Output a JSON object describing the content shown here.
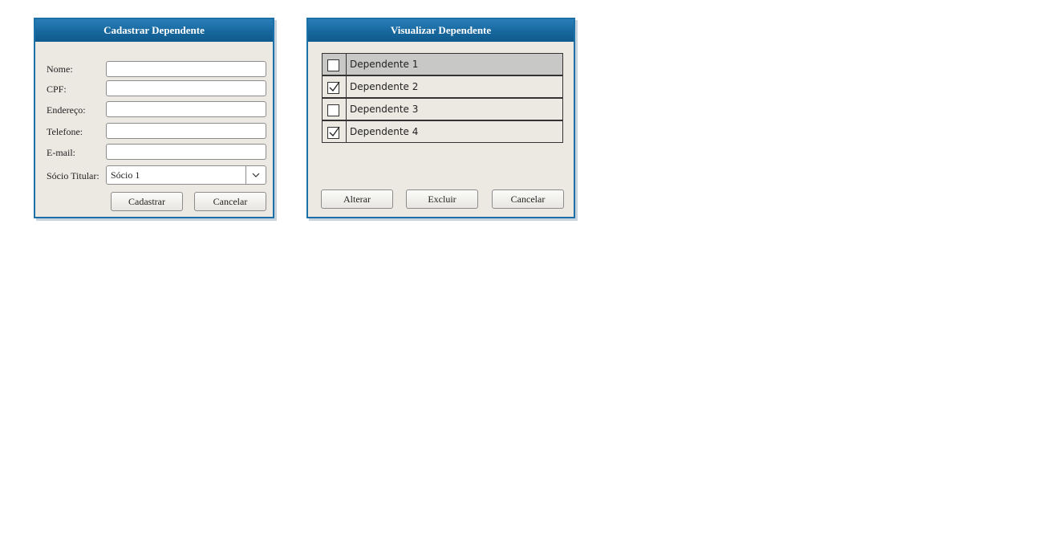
{
  "cadastrar": {
    "title": "Cadastrar Dependente",
    "fields": {
      "nome_label": "Nome:",
      "cpf_label": "CPF:",
      "endereco_label": "Endereço:",
      "telefone_label": "Telefone:",
      "email_label": "E-mail:",
      "socio_label": "Sócio Titular:",
      "nome_value": "",
      "cpf_value": "",
      "endereco_value": "",
      "telefone_value": "",
      "email_value": "",
      "socio_selected": "Sócio 1"
    },
    "buttons": {
      "cadastrar": "Cadastrar",
      "cancelar": "Cancelar"
    }
  },
  "visualizar": {
    "title": "Visualizar Dependente",
    "items": [
      {
        "label": "Dependente 1",
        "checked": false,
        "selected": true
      },
      {
        "label": "Dependente 2",
        "checked": true,
        "selected": false
      },
      {
        "label": "Dependente 3",
        "checked": false,
        "selected": false
      },
      {
        "label": "Dependente 4",
        "checked": true,
        "selected": false
      }
    ],
    "buttons": {
      "alterar": "Alterar",
      "excluir": "Excluir",
      "cancelar": "Cancelar"
    }
  },
  "colors": {
    "title_bar": "#17679e",
    "window_bg": "#ece9e3",
    "selected_row": "#c8c8c6"
  }
}
